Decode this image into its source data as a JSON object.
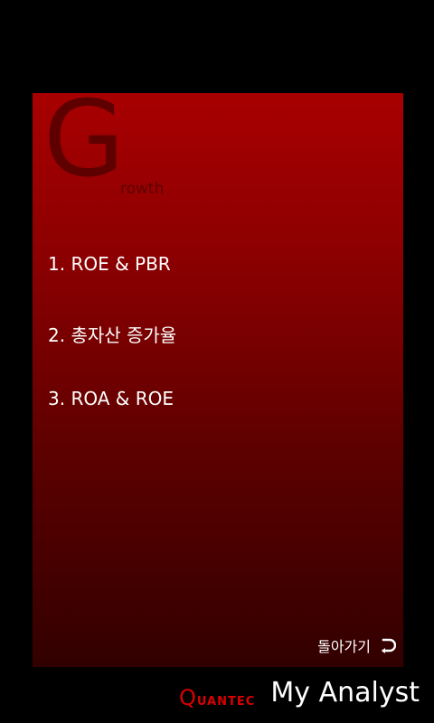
{
  "card": {
    "big_letter": "G",
    "subtitle_rest": "rowth",
    "menu": [
      {
        "label": "1. ROE & PBR"
      },
      {
        "label": "2. 총자산 증가율"
      },
      {
        "label": "3. ROA & ROE"
      }
    ],
    "back": {
      "label": "돌아가기",
      "icon": "return-arrow-icon"
    }
  },
  "footer": {
    "brand_q": "Q",
    "brand_rest": "UANTEC",
    "app_title": "My Analyst"
  },
  "colors": {
    "background": "#000000",
    "card_top": "#a80001",
    "card_bottom": "#320000",
    "watermark_letter": "#5e0000",
    "brand_red": "#d90000",
    "text": "#ffffff"
  }
}
